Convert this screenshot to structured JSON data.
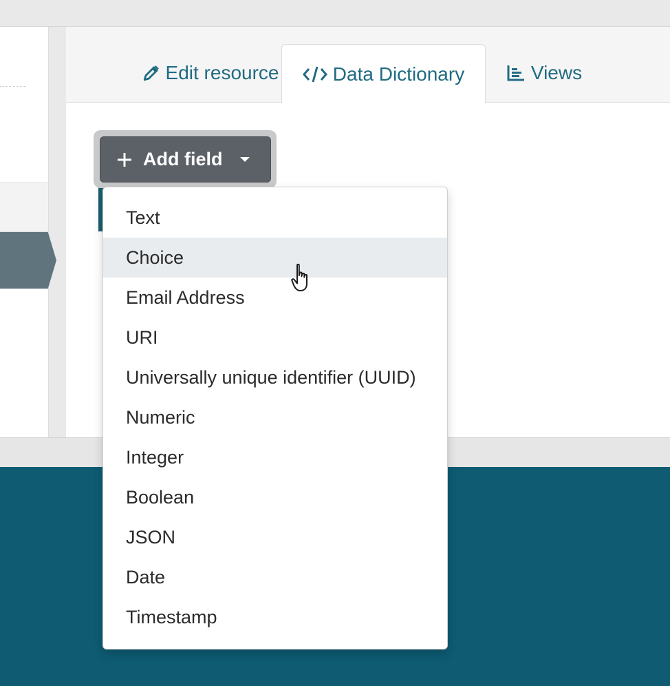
{
  "tabs": [
    {
      "label": "Edit resource",
      "icon": "pencil-icon"
    },
    {
      "label": "Data Dictionary",
      "icon": "code-icon",
      "active": true
    },
    {
      "label": "Views",
      "icon": "chart-icon"
    }
  ],
  "add_field": {
    "label": "Add field",
    "icon": "plus-icon"
  },
  "dropdown": {
    "items": [
      "Text",
      "Choice",
      "Email Address",
      "URI",
      "Universally unique identifier (UUID)",
      "Numeric",
      "Integer",
      "Boolean",
      "JSON",
      "Date",
      "Timestamp"
    ],
    "hovered": "Choice"
  },
  "colors": {
    "accent": "#206b82",
    "button": "#5c6167",
    "footer": "#0e5b72",
    "sidebar_active": "#60747e"
  }
}
